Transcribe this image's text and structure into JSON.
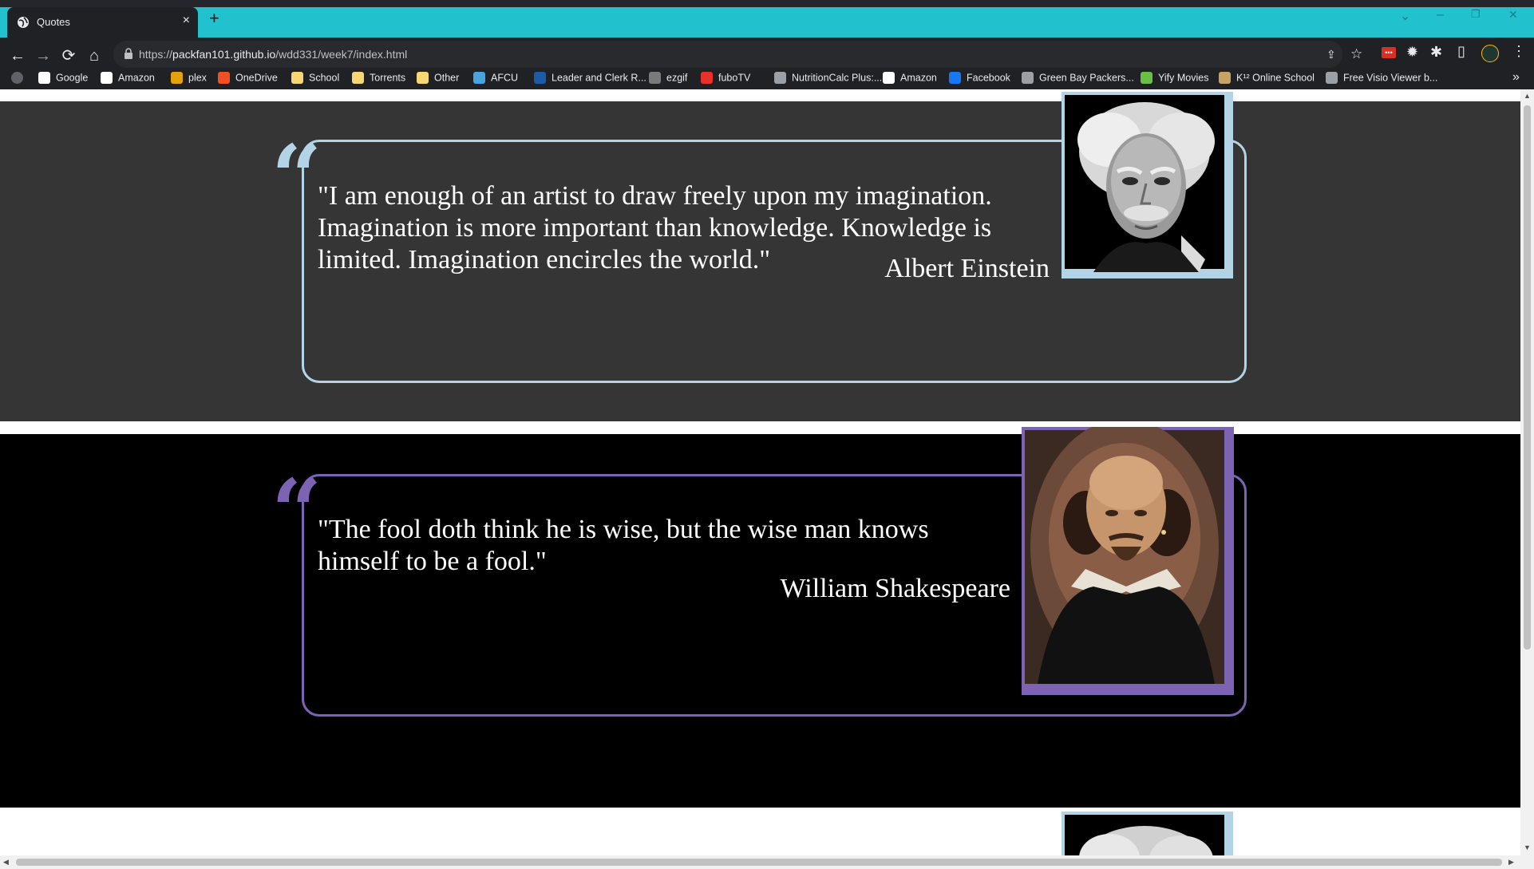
{
  "tab": {
    "title": "Quotes",
    "close": "×",
    "new_tab": "+"
  },
  "window": {
    "minimize": "–",
    "restore": "❐",
    "close": "✕",
    "tab_search": "⌄"
  },
  "toolbar": {
    "back": "←",
    "forward": "→",
    "reload": "⟳",
    "home": "⌂",
    "url_scheme": "https://",
    "url_host": "packfan101.github.io",
    "url_path": "/wdd331/week7/index.html",
    "share": "⇪",
    "bookmark_star": "☆",
    "extensions": "✱",
    "sidepanel": "▯",
    "menu": "⋮"
  },
  "bookmarks": [
    {
      "label": "Google",
      "icon": "google-icon",
      "color": "#ffffff"
    },
    {
      "label": "Amazon",
      "icon": "amazon-icon",
      "color": "#ffffff"
    },
    {
      "label": "plex",
      "icon": "plex-icon",
      "color": "#e5a00d"
    },
    {
      "label": "OneDrive",
      "icon": "microsoft-icon",
      "color": "#f25022"
    },
    {
      "label": "School",
      "icon": "folder-icon",
      "color": "#f7d774"
    },
    {
      "label": "Torrents",
      "icon": "folder-icon",
      "color": "#f7d774"
    },
    {
      "label": "Other",
      "icon": "folder-icon",
      "color": "#f7d774"
    },
    {
      "label": "AFCU",
      "icon": "afcu-icon",
      "color": "#4aa3df"
    },
    {
      "label": "Leader and Clerk R...",
      "icon": "church-icon",
      "color": "#1d5ba8"
    },
    {
      "label": "ezgif",
      "icon": "ezgif-icon",
      "color": "#7a7a7a"
    },
    {
      "label": "fuboTV",
      "icon": "fubotv-icon",
      "color": "#e8312a"
    },
    {
      "label": "NutritionCalc Plus:...",
      "icon": "globe-icon",
      "color": "#9aa0a6"
    },
    {
      "label": "Amazon",
      "icon": "amazon-icon",
      "color": "#ffffff"
    },
    {
      "label": "Facebook",
      "icon": "facebook-icon",
      "color": "#1877f2"
    },
    {
      "label": "Green Bay Packers...",
      "icon": "packers-icon",
      "color": "#9aa0a6"
    },
    {
      "label": "Yify Movies",
      "icon": "yify-icon",
      "color": "#6ac045"
    },
    {
      "label": "K¹² Online School",
      "icon": "k12-icon",
      "color": "#c8a165"
    },
    {
      "label": "Free Visio Viewer b...",
      "icon": "globe-icon",
      "color": "#9aa0a6"
    }
  ],
  "bookmarks_more": "»",
  "quotes": [
    {
      "text": "\"I am enough of an artist to draw freely upon my imagination. Imagination is more important than knowledge. Knowledge is limited. Imagination encircles the world.\"",
      "author": "Albert Einstein",
      "quote_mark": "“",
      "accent": "#b3d4e6",
      "portrait": "Albert Einstein portrait"
    },
    {
      "text": "\"The fool doth think he is wise, but the wise man knows himself to be a fool.\"",
      "author": "William Shakespeare",
      "quote_mark": "“",
      "accent": "#7d63b3",
      "portrait": "William Shakespeare portrait"
    }
  ],
  "scrollbar": {
    "up": "▲",
    "down": "▼",
    "left": "◀",
    "right": "▶"
  }
}
